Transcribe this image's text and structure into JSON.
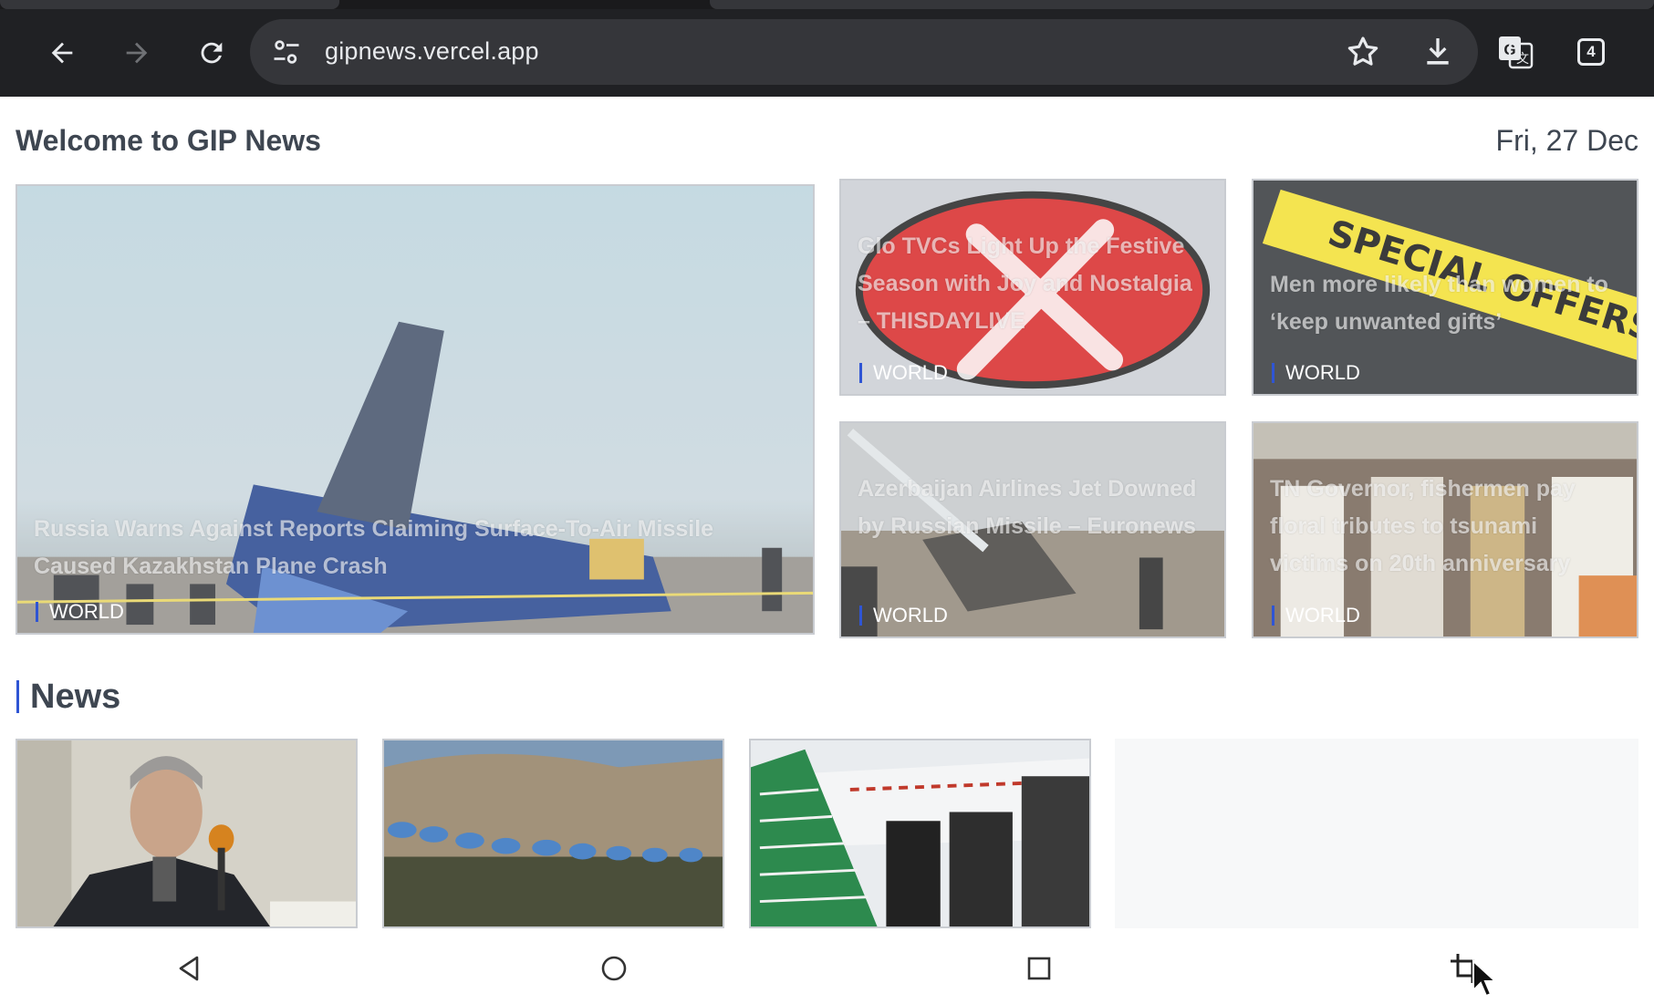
{
  "browser": {
    "url": "gipnews.vercel.app",
    "tab_count": "4",
    "icons": [
      "back-icon",
      "forward-icon",
      "reload-icon",
      "site-settings-icon",
      "bookmark-star-icon",
      "download-icon",
      "translate-icon",
      "tab-switcher-icon"
    ]
  },
  "page": {
    "title": "Welcome to GIP News",
    "date": "Fri, 27 Dec"
  },
  "featured": [
    {
      "headline": "Russia Warns Against Reports Claiming Surface-To-Air Missile Caused Kazakhstan Plane Crash",
      "category": "WORLD",
      "image": "crashed-plane-photo"
    },
    {
      "headline": "Glo TVCs Light Up the Festive Season with Joy and Nostalgia – THISDAYLIVE",
      "category": "WORLD",
      "image": "glo-logo"
    },
    {
      "headline": "Men more likely than women to ‘keep unwanted gifts’",
      "category": "WORLD",
      "image": "special-offers-sign"
    },
    {
      "headline": "Azerbaijan Airlines Jet Downed by Russian Missile – Euronews",
      "category": "WORLD",
      "image": "plane-wreckage-photo"
    },
    {
      "headline": "TN Governor, fishermen pay floral tributes to tsunami victims on 20th anniversary",
      "category": "WORLD",
      "image": "crowd-tribute-photo"
    }
  ],
  "news_section": {
    "heading": "News",
    "thumbnails": [
      "speaker-at-microphone-photo",
      "peacekeeping-soldiers-photo",
      "airport-stairs-photo"
    ]
  },
  "colors": {
    "chrome_bg": "#202124",
    "omnibox_bg": "#35363a",
    "heading_text": "#3e4651",
    "accent_bar": "#2f55d4"
  },
  "system_nav": {
    "icons": [
      "back-triangle-icon",
      "home-circle-icon",
      "recents-square-icon",
      "crop-icon",
      "mouse-cursor-icon"
    ]
  }
}
